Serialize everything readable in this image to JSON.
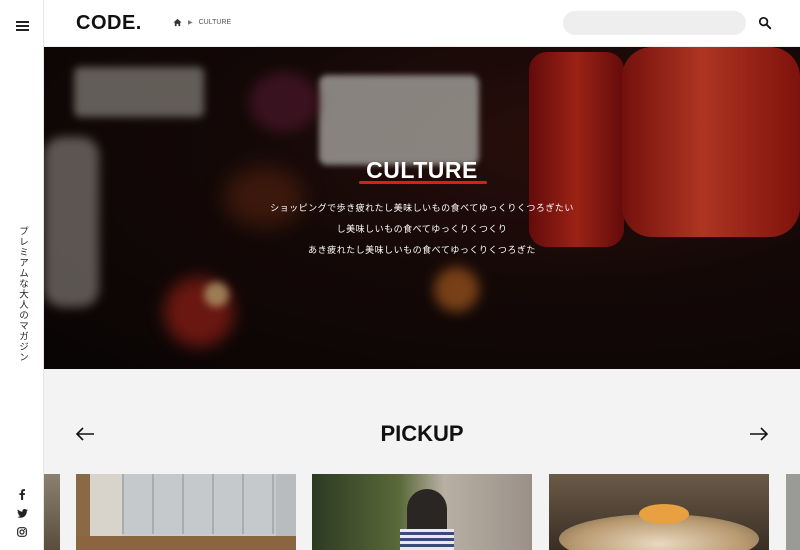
{
  "rail": {
    "tagline": "プレミアムな大人のマガジン",
    "social": [
      "facebook-icon",
      "twitter-icon",
      "instagram-icon"
    ]
  },
  "header": {
    "logo": "CODE.",
    "breadcrumb": {
      "home_icon": "home-icon",
      "separator": "▶",
      "current": "CULTURE"
    },
    "search": {
      "placeholder": "",
      "value": ""
    },
    "search_icon": "search-icon"
  },
  "hero": {
    "title": "CULTURE",
    "lines": [
      "ショッピングで歩き疲れたし美味しいもの食べてゆっくりくつろぎたい",
      "し美味しいもの食べてゆっくりくつくり",
      "あき疲れたし美味しいもの食べてゆっくりくつろぎた"
    ],
    "accent": "#d42020"
  },
  "pickup": {
    "title": "PICKUP",
    "prev_icon": "arrow-left-icon",
    "next_icon": "arrow-right-icon"
  }
}
